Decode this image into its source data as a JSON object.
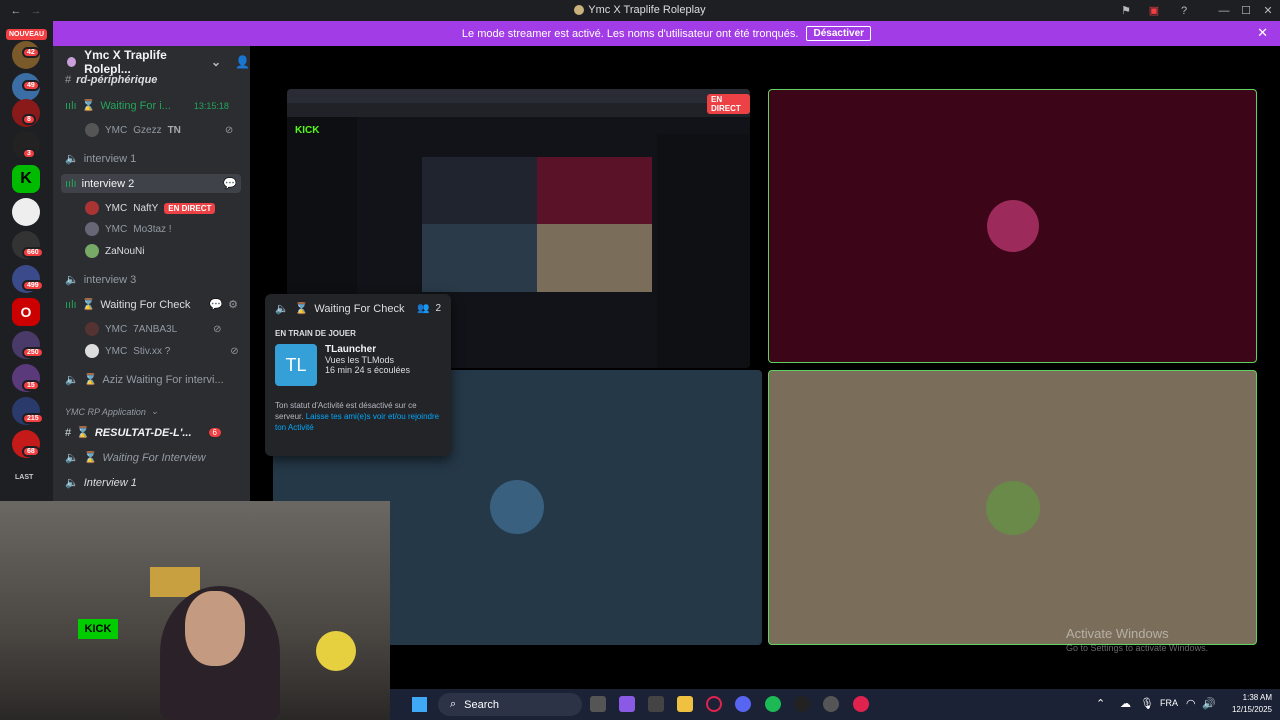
{
  "titlebar": {
    "title": "Ymc X Traplife Roleplay"
  },
  "banner": {
    "text": "Le mode streamer est activé. Les noms d'utilisateur ont été tronqués.",
    "button": "Désactiver"
  },
  "guilds": {
    "new_badge": "NOUVEAU",
    "badges": [
      "42",
      "49",
      "8",
      "3",
      "660",
      "499",
      "250",
      "15",
      "215",
      "68"
    ],
    "last_label": "LAST"
  },
  "server": {
    "name": "Ymc X Traplife Rolepl..."
  },
  "channels": {
    "periph": "rd-périphérique",
    "waiting1": "Waiting For i...",
    "waiting1_time": "13:15:18",
    "gzezz_prefix": "YMC",
    "gzezz": "Gzezz",
    "gzezz_tag": "TN",
    "interview1": "interview 1",
    "interview2": "interview 2",
    "nafty_prefix": "YMC",
    "nafty": "NaftY",
    "live": "EN DIRECT",
    "mo3taz_prefix": "YMC",
    "mo3taz": "Mo3taz !",
    "zanouni": "ZaNouNi",
    "interview3": "interview 3",
    "waitingcheck": "Waiting For Check",
    "tanba_prefix": "YMC",
    "tanba": "7ANBA3L",
    "stiv_prefix": "YMC",
    "stiv": "Stiv.xx ?",
    "aziz": "Aziz Waiting For intervi...",
    "category": "YMC RP Application",
    "resultat": "RESULTAT-DE-L'...",
    "resultat_badge": "6",
    "waiting_interview": "Waiting For Interview",
    "interview_1b": "Interview 1"
  },
  "stage": {
    "live_badge": "EN DIRECT"
  },
  "popup": {
    "channel": "Waiting For Check",
    "count": "2",
    "playing": "EN TRAIN DE JOUER",
    "game": "TLauncher",
    "detail": "Vues les TLMods",
    "elapsed": "16 min 24 s écoulées",
    "logo": "TL",
    "status_text": "Ton statut d'Activité est désactivé sur ce serveur.",
    "status_link": "Laisse tes ami(e)s voir et/ou rejoindre ton Activité"
  },
  "taskbar": {
    "search": "Search",
    "lang": "FRA",
    "time": "1:38 AM",
    "date": "12/15/2025"
  },
  "watermark": {
    "line1": "Activate Windows",
    "line2": "Go to Settings to activate Windows."
  },
  "colors": {
    "banner": "#a23ce6",
    "tile1": "#3d0618",
    "tile2": "#253848",
    "tile3": "#7a6d5a",
    "accent": "#5865f2"
  }
}
